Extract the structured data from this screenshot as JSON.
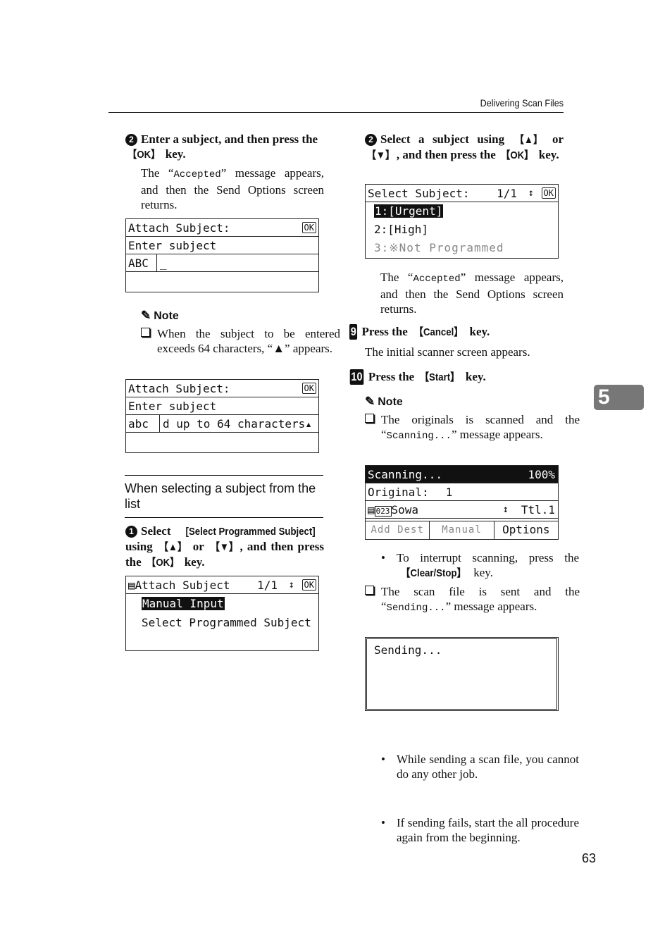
{
  "header": {
    "title": "Delivering Scan Files"
  },
  "left": {
    "step2": {
      "num": "2",
      "text_a": "Enter a subject, and then press the ",
      "key": "【OK】",
      "text_b": " key."
    },
    "step2_desc": {
      "a": "The “",
      "mono": "Accepted",
      "b": "” message appears, and then the Send Options screen returns."
    },
    "lcd1": {
      "title": "Attach Subject:",
      "ok": "OK",
      "row2": "Enter subject",
      "mode": "ABC",
      "input": "_"
    },
    "note1": {
      "heading": "Note",
      "text": "When the subject to be entered exceeds 64 characters, “▲” appears."
    },
    "lcd2": {
      "title": "Attach Subject:",
      "ok": "OK",
      "row2": "Enter subject",
      "mode": "abc",
      "input": "d up to 64 characters▴"
    },
    "section": {
      "title": "When selecting a subject from the list"
    },
    "step1": {
      "num": "1",
      "a": "Select ",
      "key1": "[Select Programmed Subject]",
      "b": " using ",
      "up": "【▲】",
      "c": " or ",
      "down": "【▼】",
      "d": ", and then press the ",
      "ok": "【OK】",
      "e": " key."
    },
    "lcd3": {
      "title": "Attach Subject",
      "page": "1/1",
      "arrows": "↕",
      "ok": "OK",
      "item1": "Manual Input",
      "item2": "Select Programmed Subject"
    }
  },
  "right": {
    "step2": {
      "num": "2",
      "a": "Select a subject using ",
      "up": "【▲】",
      "b": " or ",
      "down": "【▼】",
      "c": ", and then press the ",
      "ok": "【OK】",
      "d": " key."
    },
    "lcd4": {
      "title": "Select Subject:",
      "page": "1/1",
      "ok": "OK",
      "item1": "1:[Urgent]",
      "item2": "2:[High]",
      "item3": "3:※Not Programmed"
    },
    "step2_desc": {
      "a": "The “",
      "mono": "Accepted",
      "b": "” message appears, and then the Send Options screen returns."
    },
    "step9": {
      "num": "9",
      "a": "Press the ",
      "key": "【Cancel】",
      "b": " key.",
      "desc": "The initial scanner screen appears."
    },
    "step10": {
      "num": "10",
      "a": "Press the ",
      "key": "【Start】",
      "b": " key."
    },
    "note2": {
      "heading": "Note",
      "a": "The originals is scanned and the “",
      "mono": "Scanning...",
      "b": "” message appears."
    },
    "lcd5": {
      "status": "Scanning...",
      "percent": "100%",
      "original_label": "Original:",
      "original_count": "1",
      "dest_num": "023",
      "dest_name": "Sowa",
      "total": "Ttl.1",
      "tabs": [
        "Add Dest",
        "Manual",
        "Options"
      ]
    },
    "bullet1": {
      "a": "To interrupt scanning, press the ",
      "key": "【Clear/Stop】",
      "b": " key."
    },
    "note3": {
      "a": "The scan file is sent and the “",
      "mono": "Sending...",
      "b": "” message appears."
    },
    "lcd6": {
      "text": "Sending..."
    },
    "bullets": [
      "While sending a scan file, you cannot do any other job.",
      "If sending fails, start the all procedure again from the beginning."
    ]
  },
  "chapter_tab": "5",
  "page_number": "63"
}
